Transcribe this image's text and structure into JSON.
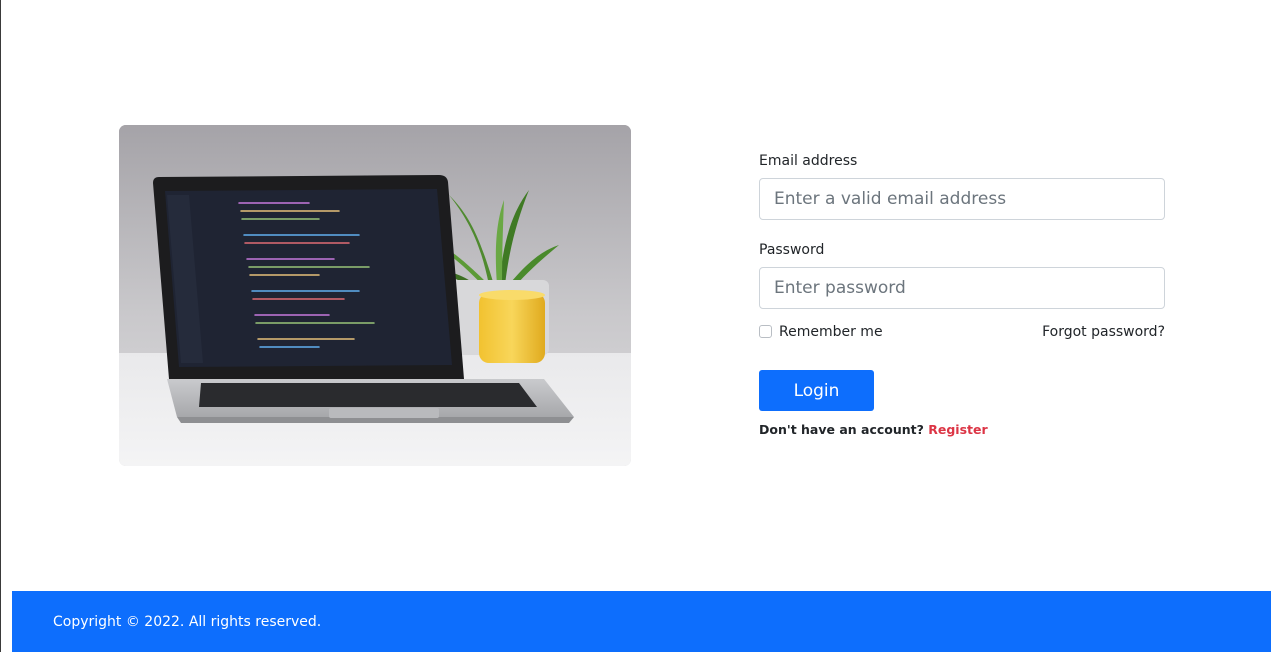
{
  "hero": {
    "image": "laptop-code-editor-photo"
  },
  "form": {
    "email": {
      "label": "Email address",
      "placeholder": "Enter a valid email address",
      "value": ""
    },
    "password": {
      "label": "Password",
      "placeholder": "Enter password",
      "value": ""
    },
    "remember": {
      "label": "Remember me",
      "checked": false
    },
    "forgot_label": "Forgot password?",
    "login_label": "Login",
    "register_prompt": "Don't have an account?",
    "register_label": "Register"
  },
  "footer": {
    "copyright": "Copyright © 2022. All rights reserved."
  },
  "colors": {
    "primary": "#0d6efd",
    "danger": "#dc3545",
    "text": "#212529"
  }
}
